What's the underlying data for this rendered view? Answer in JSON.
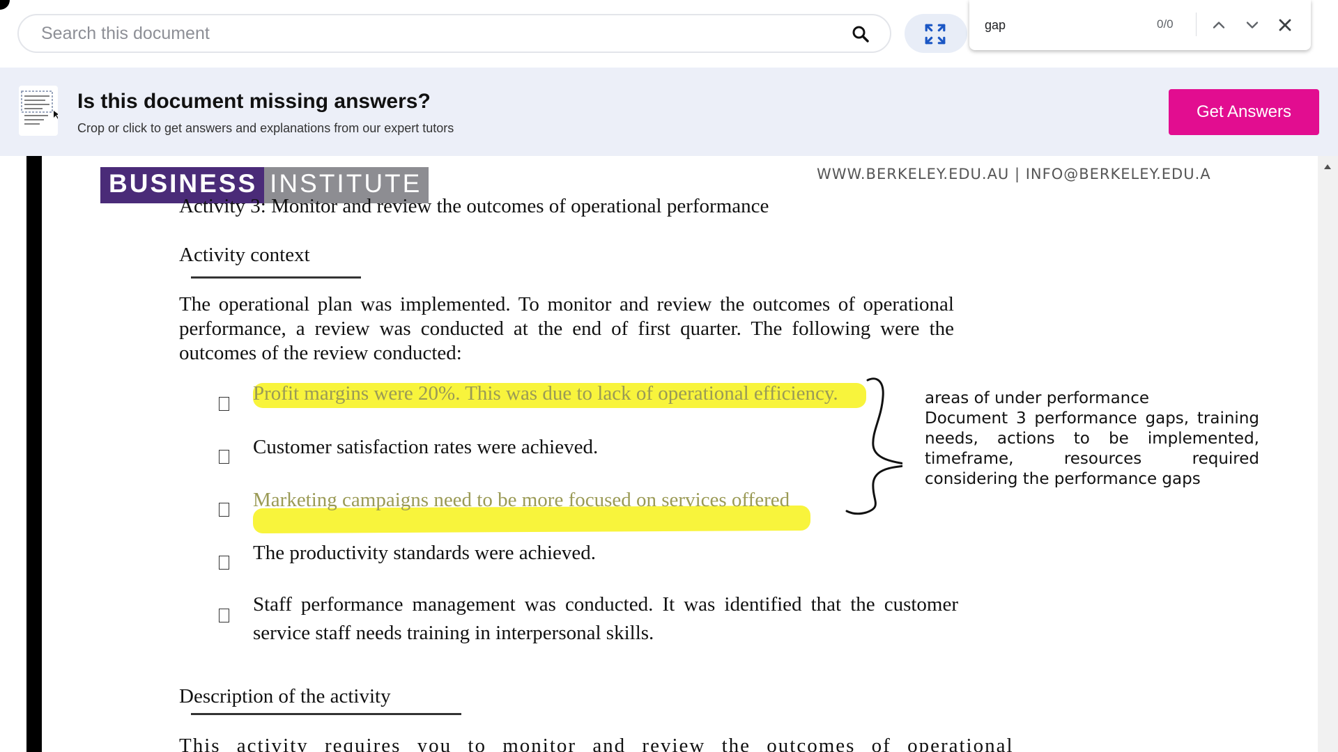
{
  "toolbar": {
    "search_placeholder": "Search this document",
    "find": {
      "query": "gap",
      "count": "0/0"
    }
  },
  "banner": {
    "title": "Is this document missing answers?",
    "subtitle": "Crop or click to get answers and explanations from our expert tutors",
    "button_label": "Get Answers",
    "button_color": "#e20d90"
  },
  "document": {
    "logo": {
      "part1": "BUSINESS",
      "part2": "INSTITUTE"
    },
    "header_contact": "WWW.BERKELEY.EDU.AU  |  INFO@BERKELEY.EDU.A",
    "activity_title": "Activity 3: Monitor and review the outcomes of operational performance",
    "context_heading": "Activity context",
    "context_paragraph": "The operational plan was implemented. To monitor and review the outcomes of operational performance, a review was conducted at the end of first quarter. The following were the outcomes of the review conducted:",
    "bullets": [
      "Profit margins were 20%. This was due to lack of operational efficiency.",
      "Customer satisfaction rates were achieved.",
      "Marketing campaigns need to be more focused on services offered",
      "The productivity standards were achieved.",
      "Staff performance management was conducted. It was identified that the customer service staff needs training in interpersonal skills."
    ],
    "annotation": {
      "line1": "areas of under performance",
      "line2": "Document 3 performance gaps, training needs, actions to be implemented, timeframe, resources required considering the performance gaps"
    },
    "description_heading": "Description of the activity",
    "description_start": "This activity requires you to monitor and review the outcomes of operational",
    "highlight_color": "#f7f327"
  }
}
